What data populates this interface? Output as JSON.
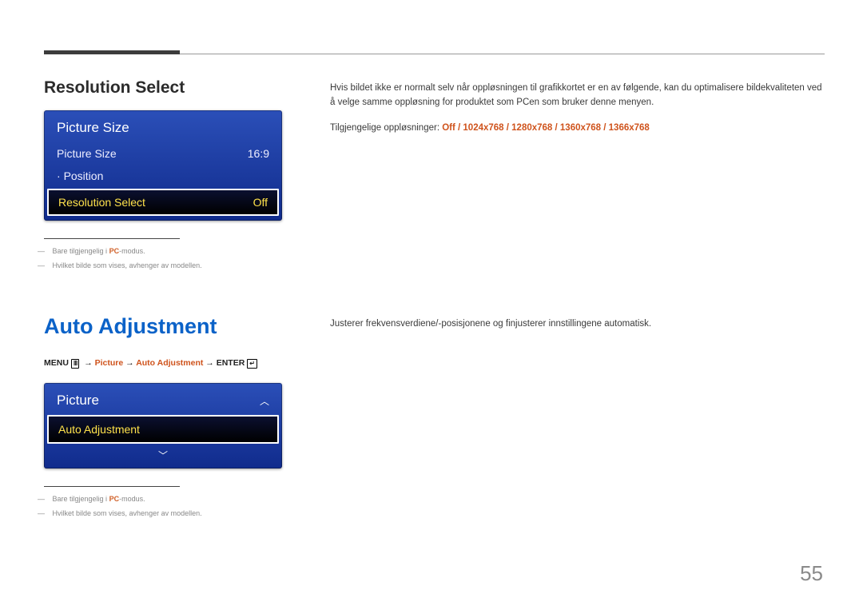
{
  "section1": {
    "title": "Resolution Select",
    "desc": "Hvis bildet ikke er normalt selv når oppløsningen til grafikkortet er en av følgende, kan du optimalisere bildekvaliteten ved å velge samme oppløsning for produktet som PCen som bruker denne menyen.",
    "resLabel": "Tilgjengelige oppløsninger: ",
    "resOptions": "Off / 1024x768 / 1280x768 / 1360x768 / 1366x768",
    "osd": {
      "title": "Picture Size",
      "row1": {
        "label": "Picture Size",
        "value": "16:9"
      },
      "row2": {
        "label": "Position"
      },
      "sel": {
        "label": "Resolution Select",
        "value": "Off"
      }
    },
    "foot1a": "Bare tilgjengelig i ",
    "foot1b": "PC",
    "foot1c": "-modus.",
    "foot2": "Hvilket bilde som vises, avhenger av modellen."
  },
  "section2": {
    "title": "Auto Adjustment",
    "desc": "Justerer frekvensverdiene/-posisjonene og finjusterer innstillingene automatisk.",
    "path": {
      "menu": "MENU",
      "p": "Picture",
      "a": "Auto Adjustment",
      "e": "ENTER"
    },
    "osd": {
      "title": "Picture",
      "sel": "Auto Adjustment"
    },
    "foot1a": "Bare tilgjengelig i ",
    "foot1b": "PC",
    "foot1c": "-modus.",
    "foot2": "Hvilket bilde som vises, avhenger av modellen."
  },
  "page": "55"
}
